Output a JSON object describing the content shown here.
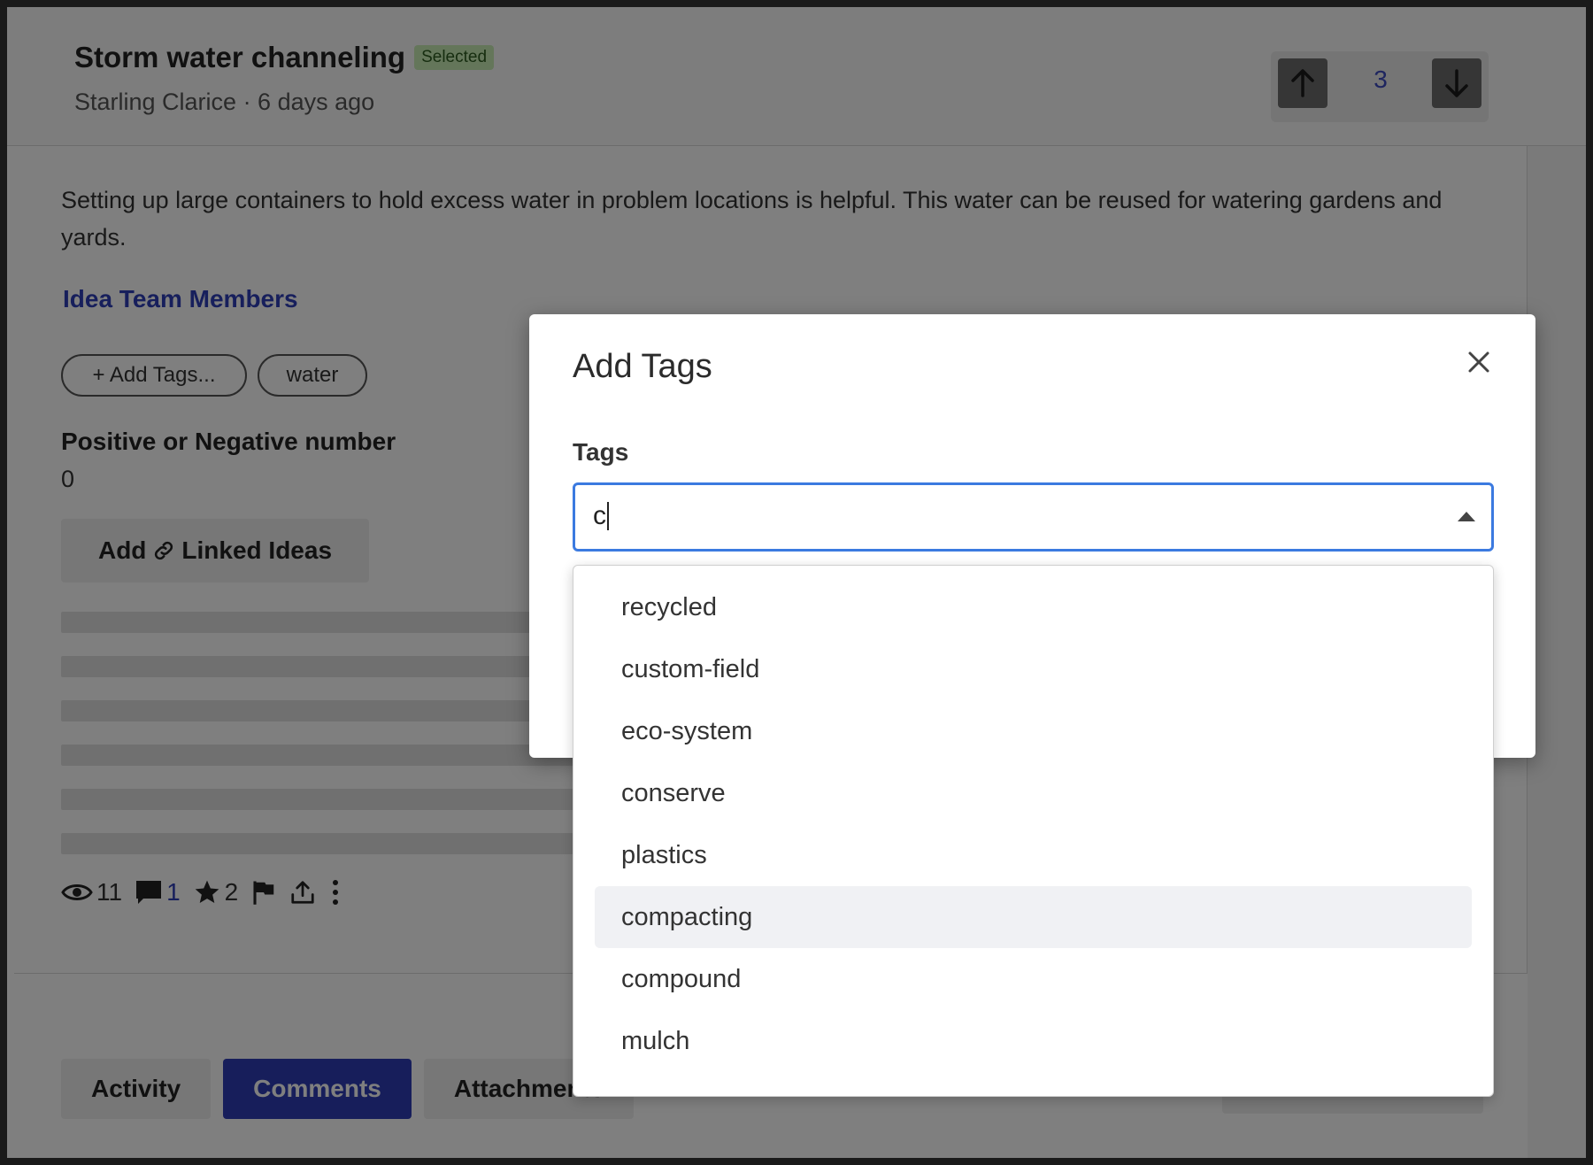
{
  "idea": {
    "title": "Storm water channeling",
    "status": "Selected",
    "meta": "Starling Clarice · 6 days ago",
    "description": "Setting up large containers to hold excess water in problem locations is helpful. This water can be reused for watering gardens and yards.",
    "team_link": "Idea Team Members",
    "tags": {
      "add_label": "+ Add Tags...",
      "existing": "water"
    },
    "custom_field": {
      "label": "Positive or Negative number",
      "value": "0"
    },
    "linked_ideas": {
      "prefix": "Add",
      "suffix": "Linked Ideas"
    },
    "stats": {
      "views": "11",
      "comments": "1",
      "stars": "2"
    }
  },
  "votes": {
    "count": "3"
  },
  "tabs": [
    {
      "label": "Activity"
    },
    {
      "label": "Comments"
    },
    {
      "label": "Attachments"
    }
  ],
  "modal": {
    "title": "Add Tags",
    "field_label": "Tags",
    "input_value": "c",
    "options": [
      {
        "label": "recycled"
      },
      {
        "label": "custom-field"
      },
      {
        "label": "eco-system"
      },
      {
        "label": "conserve"
      },
      {
        "label": "plastics"
      },
      {
        "label": "compacting"
      },
      {
        "label": "compound"
      },
      {
        "label": "mulch"
      }
    ]
  },
  "colors": {
    "accent": "#2f3db6",
    "link": "#2f3fb8",
    "focus_border": "#3b7ae0",
    "status_badge": "#c9ecb5"
  }
}
